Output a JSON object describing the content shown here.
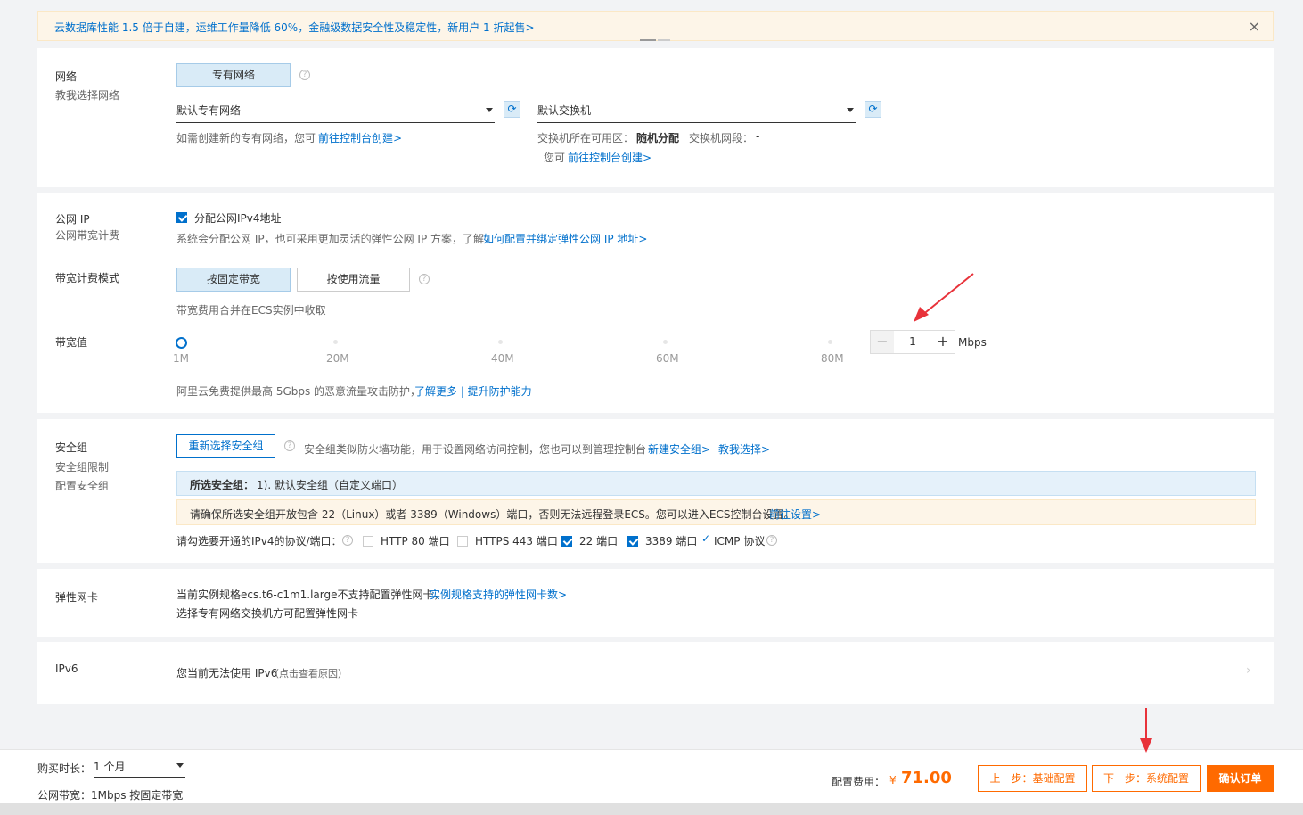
{
  "banner": {
    "text": "云数据库性能 1.5 倍于自建，运维工作量降低 60%，金融级数据安全性及稳定性，新用户 1 折起售>",
    "close": "×"
  },
  "network": {
    "title": "网络",
    "sub": "教我选择网络",
    "vpc_button": "专有网络",
    "vpc_select": "默认专有网络",
    "vsw_select": "默认交换机",
    "vpc_hint": "如需创建新的专有网络，您可",
    "vpc_hint_link": "前往控制台创建>",
    "zone_label": "交换机所在可用区：",
    "zone_value": "随机分配",
    "cidr_label": "交换机网段：",
    "cidr_value": "-",
    "vsw_hint": "您可",
    "vsw_hint_link": "前往控制台创建>"
  },
  "public_ip": {
    "title": "公网 IP",
    "sub": "公网带宽计费",
    "checkbox_label": "分配公网IPv4地址",
    "desc": "系统会分配公网 IP，也可采用更加灵活的弹性公网 IP 方案，了解",
    "desc_link": "如何配置并绑定弹性公网 IP 地址>",
    "billing_title": "带宽计费模式",
    "billing_fixed": "按固定带宽",
    "billing_traffic": "按使用流量",
    "billing_note": "带宽费用合并在ECS实例中收取",
    "bw_title": "带宽值",
    "ticks": [
      "1M",
      "20M",
      "40M",
      "60M",
      "80M"
    ],
    "bw_value": "1",
    "bw_unit": "Mbps",
    "bw_minus": "−",
    "bw_plus": "+",
    "ddos_text": "阿里云免费提供最高 5Gbps 的恶意流量攻击防护，",
    "ddos_link": "了解更多 | 提升防护能力"
  },
  "security": {
    "title": "安全组",
    "sub1": "安全组限制",
    "sub2": "配置安全组",
    "reselect_button": "重新选择安全组",
    "desc": "安全组类似防火墙功能，用于设置网络访问控制，您也可以到管理控制台",
    "link_new": "新建安全组>",
    "link_teach": "教我选择>",
    "selected_label": "所选安全组：",
    "selected_value": "1). 默认安全组（自定义端口）",
    "warn_text": "请确保所选安全组开放包含 22（Linux）或者 3389（Windows）端口，否则无法远程登录ECS。您可以进入ECS控制台设置。",
    "warn_link": "前往设置>",
    "ports_label": "请勾选要开通的IPv4的协议/端口：",
    "ports": [
      {
        "label": "HTTP 80 端口",
        "checked": false
      },
      {
        "label": "HTTPS 443 端口",
        "checked": false
      },
      {
        "label": "22 端口",
        "checked": true
      },
      {
        "label": "3389 端口",
        "checked": true
      }
    ],
    "icmp_label": "ICMP 协议"
  },
  "eni": {
    "title": "弹性网卡",
    "line1": "当前实例规格ecs.t6-c1m1.large不支持配置弹性网卡，",
    "line1_link": "实例规格支持的弹性网卡数>",
    "line2": "选择专有网络交换机方可配置弹性网卡"
  },
  "ipv6": {
    "title": "IPv6",
    "text": "您当前无法使用 IPv6",
    "reason": "（点击查看原因）"
  },
  "footer": {
    "duration_label": "购买时长：",
    "duration_value": "1 个月",
    "bandwidth_summary": "公网带宽：1Mbps 按固定带宽",
    "fee_label": "配置费用：",
    "currency": "¥",
    "price": "71.00",
    "prev_button": "上一步：基础配置",
    "next_button": "下一步：系统配置",
    "confirm_button": "确认订单"
  },
  "colors": {
    "accent": "#0070cc",
    "primary_action": "#ff6a00",
    "annotation_arrow": "#e8323a"
  }
}
